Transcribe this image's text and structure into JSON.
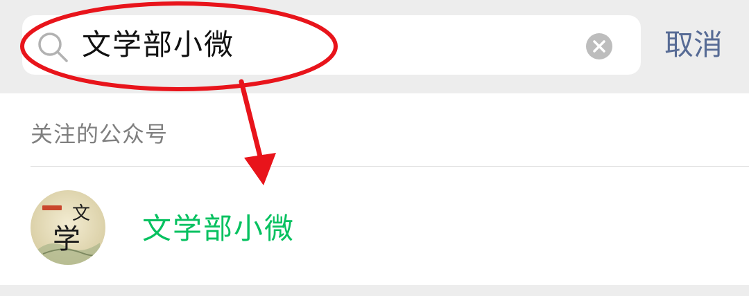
{
  "search": {
    "query": "文学部小微",
    "icon": "search-icon",
    "clear_icon": "clear-icon",
    "cancel_label": "取消",
    "accent_color": "#576b95"
  },
  "results": {
    "section_header": "关注的公众号",
    "items": [
      {
        "name": "文学部小微",
        "name_color": "#07c160",
        "avatar_text_top": "文",
        "avatar_text_bottom": "学"
      }
    ]
  },
  "annotation": {
    "color": "#e8141b",
    "ellipse": "highlight-ellipse",
    "arrow": "pointer-arrow"
  }
}
